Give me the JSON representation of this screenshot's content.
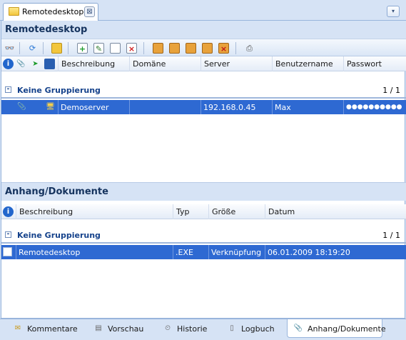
{
  "tab": {
    "title": "Remotedesktop",
    "close_glyph": "⊠",
    "menu_glyph": "▾"
  },
  "main": {
    "title": "Remotedesktop",
    "columns": [
      "Beschreibung",
      "Domäne",
      "Server",
      "Benutzername",
      "Passwort"
    ],
    "group": {
      "label": "Keine Gruppierung",
      "count": "1 / 1"
    },
    "rows": [
      {
        "beschreibung": "Demoserver",
        "domaene": "",
        "server": "192.168.0.45",
        "benutzername": "Max",
        "passwort": "●●●●●●●●●●"
      }
    ]
  },
  "attachments": {
    "title": "Anhang/Dokumente",
    "columns": [
      "Beschreibung",
      "Typ",
      "Größe",
      "Datum"
    ],
    "group": {
      "label": "Keine Gruppierung",
      "count": "1 / 1"
    },
    "rows": [
      {
        "beschreibung": "Remotedesktop",
        "typ": ".EXE",
        "groesse": "Verknüpfung",
        "datum": "06.01.2009 18:19:20"
      }
    ]
  },
  "bottom_tabs": [
    {
      "label": "Kommentare",
      "icon": "comment-icon"
    },
    {
      "label": "Vorschau",
      "icon": "preview-icon"
    },
    {
      "label": "Historie",
      "icon": "history-icon"
    },
    {
      "label": "Logbuch",
      "icon": "logbook-icon"
    },
    {
      "label": "Anhang/Dokumente",
      "icon": "paperclip-icon"
    }
  ],
  "colors": {
    "selection": "#2e69d2",
    "header_bg": "#d6e3f5",
    "title_text": "#15335e"
  }
}
